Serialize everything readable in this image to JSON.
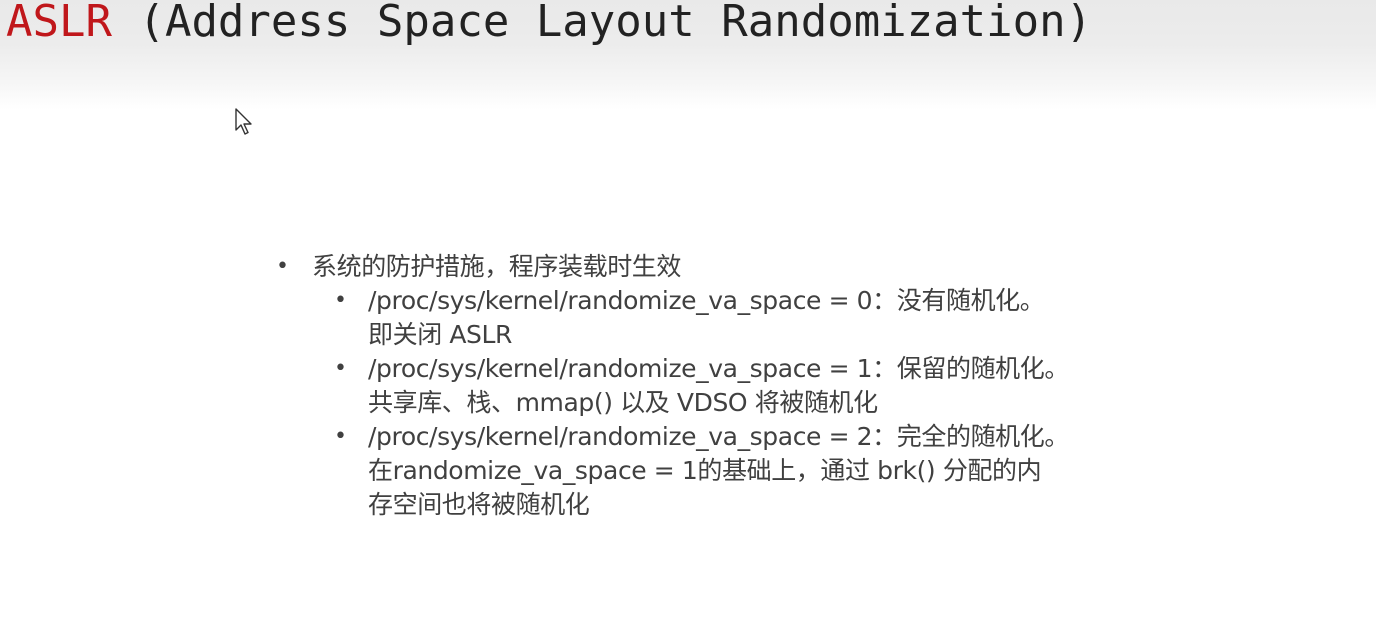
{
  "slide": {
    "title_accent": "ASLR",
    "title_rest": " (Address Space Layout Randomization)",
    "accent_color": "#c0171b",
    "bullet_glyph": "•",
    "main_point": "系统的防护措施，程序装载时生效",
    "sub_points": [
      {
        "line1": "/proc/sys/kernel/randomize_va_space = 0：没有随机化。",
        "line2": "即关闭 ASLR",
        "line3": ""
      },
      {
        "line1": "/proc/sys/kernel/randomize_va_space = 1：保留的随机化。",
        "line2": "共享库、栈、mmap() 以及 VDSO 将被随机化",
        "line3": ""
      },
      {
        "line1": "/proc/sys/kernel/randomize_va_space = 2：完全的随机化。",
        "line2": "在randomize_va_space = 1的基础上，通过 brk() 分配的内",
        "line3": "存空间也将被随机化"
      }
    ]
  },
  "cursor_icon": "mouse-pointer-icon"
}
